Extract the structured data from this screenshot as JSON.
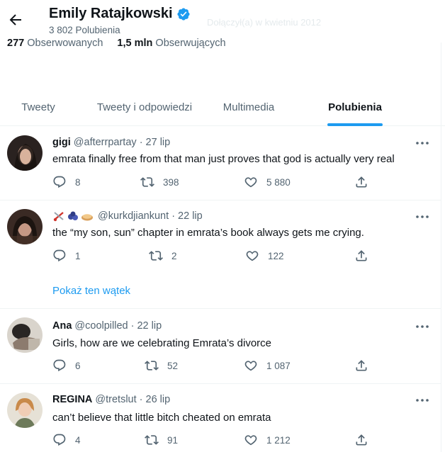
{
  "profile": {
    "name": "Emily Ratajkowski",
    "likes_count": "3 802 Polubienia",
    "following_count": "277",
    "following_label": "Obserwowanych",
    "followers_count": "1,5 mln",
    "followers_label": "Obserwujących",
    "ghost_text": "Dołączył(a) w kwietniu 2012",
    "verified_color": "#1d9bf0"
  },
  "tabs": [
    {
      "label": "Tweety",
      "active": false
    },
    {
      "label": "Tweety i odpowiedzi",
      "active": false
    },
    {
      "label": "Multimedia",
      "active": false
    },
    {
      "label": "Polubienia",
      "active": true
    }
  ],
  "tweets": [
    {
      "name": "gigi",
      "handle": "@afterrpartay",
      "date": "· 27 lip",
      "text": "emrata finally free from that man just proves that god is actually very real",
      "replies": "8",
      "retweets": "398",
      "likes": "5 880"
    },
    {
      "name": "",
      "name_emojis": [
        "scissors-emoji",
        "blueberries-emoji",
        "pie-emoji"
      ],
      "handle": "@kurkdjiankunt",
      "date": "· 22 lip",
      "text": "the “my son, sun” chapter in emrata’s book always gets me crying.",
      "replies": "1",
      "retweets": "2",
      "likes": "122",
      "thread_link": "Pokaż ten wątek"
    },
    {
      "name": "Ana",
      "handle": "@coolpilled",
      "date": "· 22 lip",
      "text": "Girls, how are we celebrating Emrata’s divorce",
      "replies": "6",
      "retweets": "52",
      "likes": "1 087"
    },
    {
      "name": "REGINA",
      "handle": "@tretslut",
      "date": "· 26 lip",
      "text": "can’t believe that little bitch cheated on emrata",
      "replies": "4",
      "retweets": "91",
      "likes": "1 212"
    }
  ],
  "colors": {
    "accent": "#1d9bf0",
    "text_primary": "#0f1419",
    "text_secondary": "#536471",
    "divider": "#eff3f4"
  }
}
